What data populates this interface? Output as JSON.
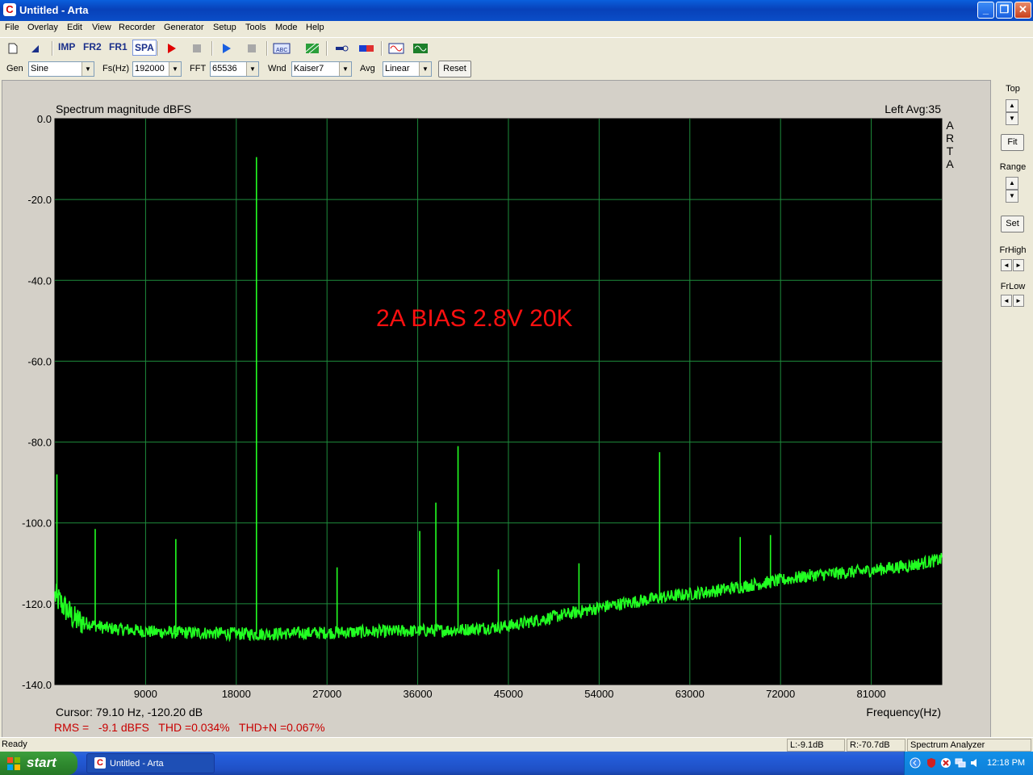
{
  "window": {
    "title": "Untitled - Arta",
    "min_label": "_",
    "max_label": "❐",
    "close_label": "✕",
    "app_icon_glyph": "C"
  },
  "menu": [
    "File",
    "Overlay",
    "Edit",
    "View",
    "Recorder",
    "Generator",
    "Setup",
    "Tools",
    "Mode",
    "Help"
  ],
  "toolbar": {
    "imp": "IMP",
    "fr2": "FR2",
    "fr1": "FR1",
    "spa": "SPA"
  },
  "controls": {
    "gen_label": "Gen",
    "gen_value": "Sine",
    "fs_label": "Fs(Hz)",
    "fs_value": "192000",
    "fft_label": "FFT",
    "fft_value": "65536",
    "wnd_label": "Wnd",
    "wnd_value": "Kaiser7",
    "avg_label": "Avg",
    "avg_value": "Linear",
    "reset_label": "Reset"
  },
  "side": {
    "top_label": "Top",
    "fit_label": "Fit",
    "range_label": "Range",
    "set_label": "Set",
    "frhigh_label": "FrHigh",
    "frlow_label": "FrLow",
    "up": "▲",
    "down": "▼",
    "left": "◄",
    "right": "►"
  },
  "chart_data": {
    "type": "line",
    "title": "Spectrum magnitude dBFS",
    "channel_info": "Left  Avg:35",
    "vertical_brand": [
      "A",
      "R",
      "T",
      "A"
    ],
    "annotation": "2A BIAS 2.8V 20K",
    "xlabel": "Frequency(Hz)",
    "xlim": [
      0,
      88000
    ],
    "ylim": [
      -140,
      0
    ],
    "xticks": [
      9000,
      18000,
      27000,
      36000,
      45000,
      54000,
      63000,
      72000,
      81000
    ],
    "yticks": [
      0,
      -20,
      -40,
      -60,
      -80,
      -100,
      -120,
      -140
    ],
    "ytick_labels": [
      "0.0",
      "-20.0",
      "-40.0",
      "-60.0",
      "-80.0",
      "-100.0",
      "-120.0",
      "-140.0"
    ],
    "grid": true,
    "colors": {
      "background": "#000000",
      "grid": "#1e8c3c",
      "trace": "#22ff22",
      "annotation": "#ff1010"
    },
    "noise_floor": [
      [
        0,
        -118
      ],
      [
        2000,
        -124
      ],
      [
        5000,
        -126
      ],
      [
        10000,
        -127
      ],
      [
        20000,
        -127.5
      ],
      [
        30000,
        -127
      ],
      [
        40000,
        -126.5
      ],
      [
        45000,
        -125.5
      ],
      [
        50000,
        -123
      ],
      [
        55000,
        -120.5
      ],
      [
        60000,
        -118.5
      ],
      [
        65000,
        -117
      ],
      [
        70000,
        -115
      ],
      [
        75000,
        -113
      ],
      [
        80000,
        -112
      ],
      [
        85000,
        -110.5
      ],
      [
        88000,
        -109
      ]
    ],
    "peaks": [
      {
        "x": 20000,
        "y": -9.5
      },
      {
        "x": 40000,
        "y": -81
      },
      {
        "x": 60000,
        "y": -82.5
      },
      {
        "x": 37800,
        "y": -95
      },
      {
        "x": 4000,
        "y": -101.5
      },
      {
        "x": 12000,
        "y": -104
      },
      {
        "x": 28000,
        "y": -111
      },
      {
        "x": 36200,
        "y": -102
      },
      {
        "x": 44000,
        "y": -111.5
      },
      {
        "x": 52000,
        "y": -110
      },
      {
        "x": 68000,
        "y": -103.5
      },
      {
        "x": 71000,
        "y": -103
      },
      {
        "x": 200,
        "y": -88
      }
    ],
    "readouts": {
      "cursor": "Cursor: 79.10 Hz, -120.20 dB",
      "rms": "RMS =   -9.1 dBFS   THD =0.034%   THD+N =0.067%"
    }
  },
  "status": {
    "ready": "Ready",
    "left_level": "L:-9.1dB",
    "right_level": "R:-70.7dB",
    "mode": "Spectrum Analyzer"
  },
  "taskbar": {
    "start": "start",
    "task": "Untitled - Arta",
    "clock": "12:18 PM"
  }
}
